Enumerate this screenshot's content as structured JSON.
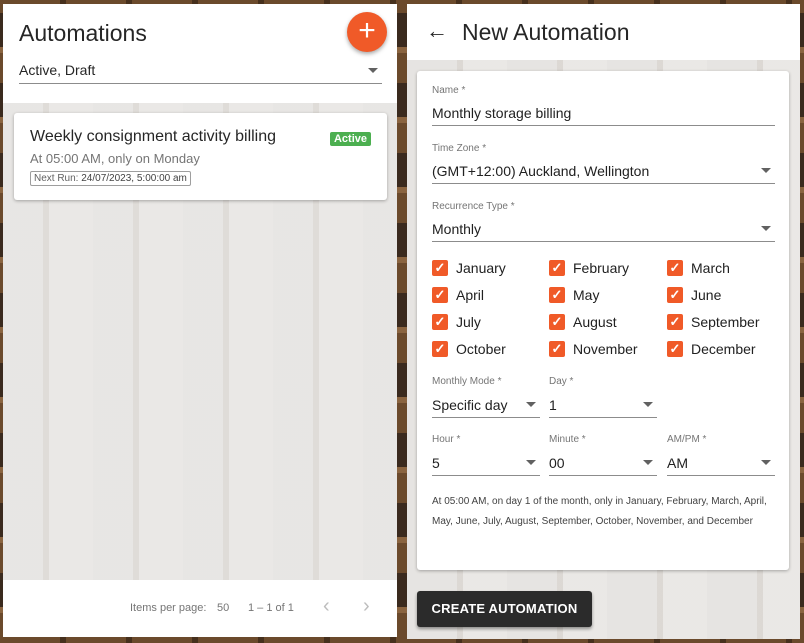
{
  "left": {
    "title": "Automations",
    "add_icon": "plus-icon",
    "filter_value": "Active, Draft",
    "card": {
      "title": "Weekly consignment activity billing",
      "badge": "Active",
      "schedule": "At 05:00 AM, only on Monday",
      "next_run_label": "Next Run:",
      "next_run_value": "24/07/2023, 5:00:00 am"
    },
    "footer": {
      "items_per_page_label": "Items per page:",
      "items_per_page_value": "50",
      "range": "1 – 1 of 1",
      "prev_icon": "chevron-left-icon",
      "next_icon": "chevron-right-icon"
    }
  },
  "right": {
    "back_icon": "arrow-left-icon",
    "title": "New Automation",
    "name_label": "Name *",
    "name_value": "Monthly storage billing",
    "timezone_label": "Time Zone *",
    "timezone_value": "(GMT+12:00) Auckland, Wellington",
    "recurrence_label": "Recurrence Type *",
    "recurrence_value": "Monthly",
    "months": [
      {
        "label": "January",
        "checked": true
      },
      {
        "label": "February",
        "checked": true
      },
      {
        "label": "March",
        "checked": true
      },
      {
        "label": "April",
        "checked": true
      },
      {
        "label": "May",
        "checked": true
      },
      {
        "label": "June",
        "checked": true
      },
      {
        "label": "July",
        "checked": true
      },
      {
        "label": "August",
        "checked": true
      },
      {
        "label": "September",
        "checked": true
      },
      {
        "label": "October",
        "checked": true
      },
      {
        "label": "November",
        "checked": true
      },
      {
        "label": "December",
        "checked": true
      }
    ],
    "monthly_mode_label": "Monthly Mode *",
    "monthly_mode_value": "Specific day",
    "day_label": "Day *",
    "day_value": "1",
    "hour_label": "Hour *",
    "hour_value": "5",
    "minute_label": "Minute *",
    "minute_value": "00",
    "ampm_label": "AM/PM *",
    "ampm_value": "AM",
    "summary": "At 05:00 AM, on day 1 of the month, only in January, February, March, April, May, June, July, August, September, October, November, and December",
    "create_label": "CREATE AUTOMATION"
  },
  "colors": {
    "accent": "#f05a28",
    "badge_active": "#4caf50",
    "button_dark": "#2b2b2b"
  }
}
